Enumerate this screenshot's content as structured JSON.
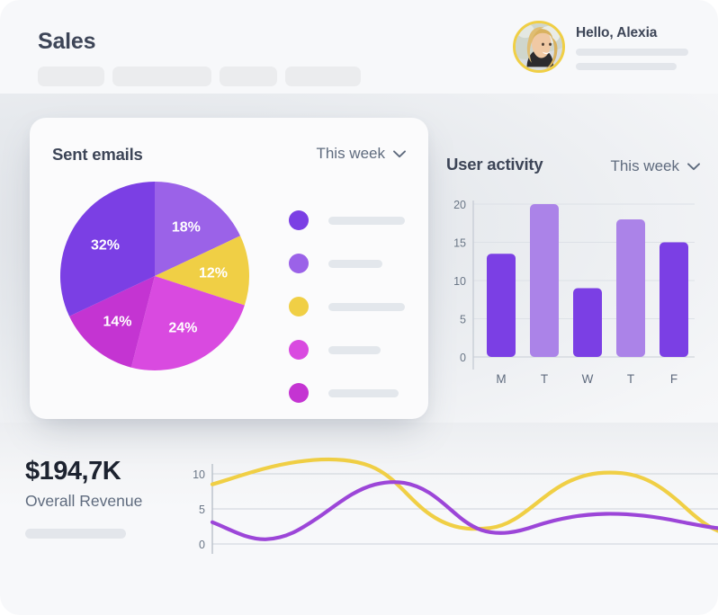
{
  "header": {
    "title": "Sales",
    "nav_pills": [
      74,
      110,
      64,
      84
    ],
    "user": {
      "greeting": "Hello, Alexia",
      "avatar_name": "avatar-alexia",
      "ring_color": "#f0cf45",
      "placeholder_bars": [
        125,
        112
      ]
    }
  },
  "emails_card": {
    "title": "Sent emails",
    "period": {
      "label": "This week",
      "icon": "chevron-down-icon"
    },
    "legend_bars": [
      85,
      60,
      85,
      58,
      78
    ],
    "chart_data": {
      "type": "pie",
      "title": "Sent emails",
      "labels": [
        "18%",
        "12%",
        "24%",
        "14%",
        "32%"
      ],
      "values": [
        18,
        12,
        24,
        14,
        32
      ],
      "colors": [
        "#9b62e8",
        "#f0cf45",
        "#d94ae0",
        "#c434d2",
        "#7b3fe4"
      ],
      "legend": [
        "",
        "",
        "",
        "",
        ""
      ],
      "legend_position": "right",
      "grid": false
    }
  },
  "activity_panel": {
    "title": "User activity",
    "period": {
      "label": "This week",
      "icon": "chevron-down-icon"
    },
    "chart_data": {
      "type": "bar",
      "title": "User activity",
      "categories": [
        "M",
        "T",
        "W",
        "T",
        "F"
      ],
      "values": [
        13.5,
        20,
        9,
        18,
        15
      ],
      "colors": [
        "#7b3fe4",
        "#ab83e8",
        "#7b3fe4",
        "#ab83e8",
        "#7b3fe4"
      ],
      "xlabel": "",
      "ylabel": "",
      "ylim": [
        0,
        20
      ],
      "yticks": [
        0,
        5,
        10,
        15,
        20
      ],
      "grid": true
    }
  },
  "revenue": {
    "value": "$194,7K",
    "label": "Overall Revenue",
    "placeholder_bar_width": 112,
    "chart_data": {
      "type": "line",
      "title": "Overall Revenue",
      "x": [
        0,
        1,
        2,
        3,
        4,
        5,
        6,
        7,
        8,
        9,
        10,
        11,
        12
      ],
      "series": [
        {
          "name": "series-yellow",
          "color": "#f0cf45",
          "values": [
            8.5,
            10.6,
            12.2,
            12.7,
            12.2,
            10.4,
            7.6,
            4.2,
            2.4,
            2.3,
            5.2,
            9.4,
            11.9,
            11.1,
            6.6
          ]
        },
        {
          "name": "series-purple",
          "color": "#9c46d8",
          "values": [
            3.1,
            1.4,
            0.7,
            1.2,
            2.7,
            5.0,
            7.0,
            8.4,
            8.6,
            7.4,
            5.4,
            3.3,
            2.1,
            2.3,
            3.2,
            3.8,
            3.0
          ]
        }
      ],
      "ylim": [
        0,
        13
      ],
      "yticks": [
        0,
        5,
        10
      ],
      "xlabel": "",
      "ylabel": "",
      "grid": true,
      "legend_position": "none"
    }
  }
}
